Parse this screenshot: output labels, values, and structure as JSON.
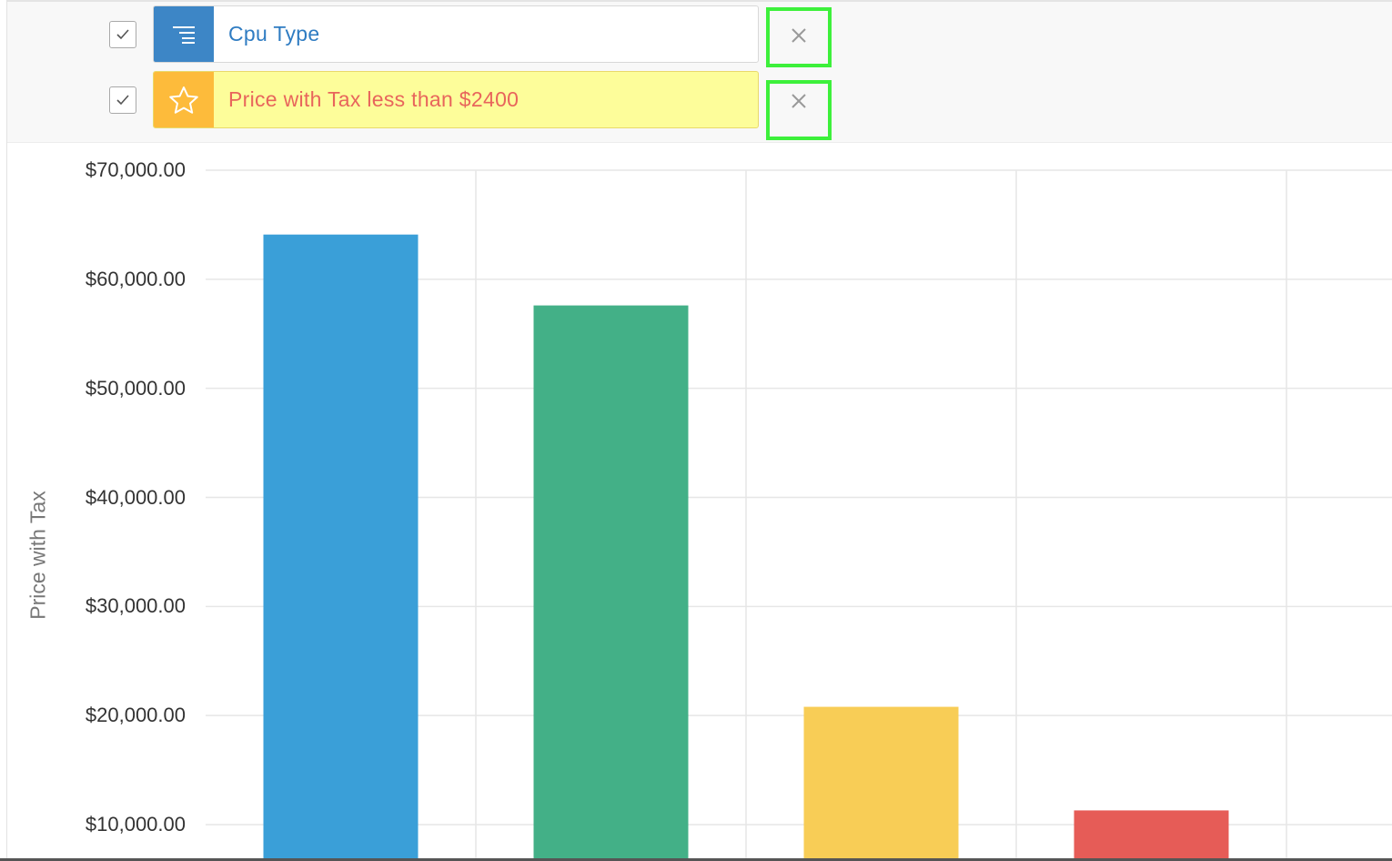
{
  "filters": [
    {
      "label": "Cpu Type",
      "icon": "list-icon",
      "style": "blue",
      "checked": true
    },
    {
      "label": "Price with Tax less than $2400",
      "icon": "star-icon",
      "style": "yellow",
      "checked": true
    }
  ],
  "chart_data": {
    "type": "bar",
    "ylabel": "Price with Tax",
    "yticks": [
      "$10,000.00",
      "$20,000.00",
      "$30,000.00",
      "$40,000.00",
      "$50,000.00",
      "$60,000.00",
      "$70,000.00"
    ],
    "ylim_visible": [
      10000,
      70000
    ],
    "grid": true,
    "values": [
      64100,
      57600,
      20800,
      11300
    ],
    "colors": [
      "#3a9fd8",
      "#43b087",
      "#f8cd56",
      "#e65c57"
    ]
  }
}
